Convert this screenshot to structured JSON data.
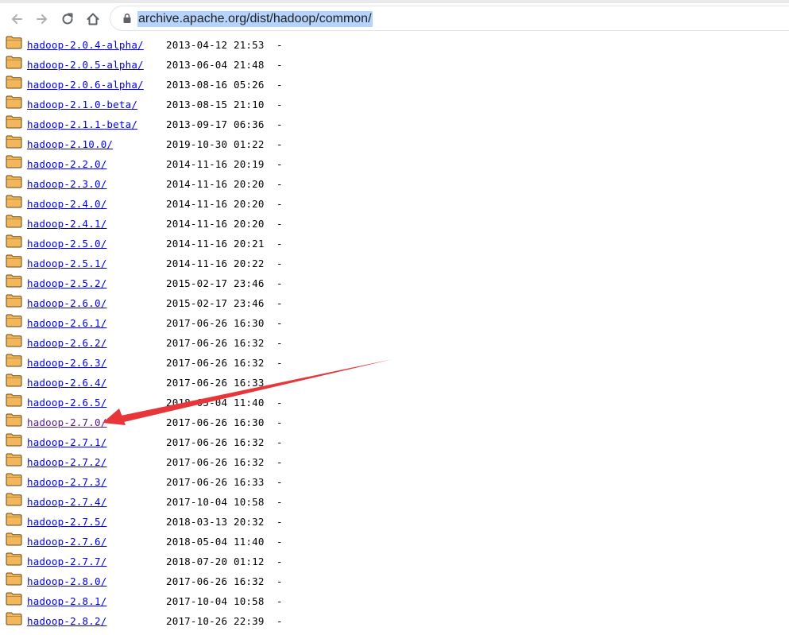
{
  "browser": {
    "url": "archive.apache.org/dist/hadoop/common/",
    "icons": [
      "back-icon",
      "forward-icon",
      "reload-icon",
      "home-icon",
      "lock-icon"
    ]
  },
  "listing": {
    "folder_icon": "folder-icon",
    "entries": [
      {
        "name": "hadoop-2.0.4-alpha/",
        "date": "2013-04-12 21:53",
        "size": "-"
      },
      {
        "name": "hadoop-2.0.5-alpha/",
        "date": "2013-06-04 21:48",
        "size": "-"
      },
      {
        "name": "hadoop-2.0.6-alpha/",
        "date": "2013-08-16 05:26",
        "size": "-"
      },
      {
        "name": "hadoop-2.1.0-beta/",
        "date": "2013-08-15 21:10",
        "size": "-"
      },
      {
        "name": "hadoop-2.1.1-beta/",
        "date": "2013-09-17 06:36",
        "size": "-"
      },
      {
        "name": "hadoop-2.10.0/",
        "date": "2019-10-30 01:22",
        "size": "-"
      },
      {
        "name": "hadoop-2.2.0/",
        "date": "2014-11-16 20:19",
        "size": "-"
      },
      {
        "name": "hadoop-2.3.0/",
        "date": "2014-11-16 20:20",
        "size": "-"
      },
      {
        "name": "hadoop-2.4.0/",
        "date": "2014-11-16 20:20",
        "size": "-"
      },
      {
        "name": "hadoop-2.4.1/",
        "date": "2014-11-16 20:20",
        "size": "-"
      },
      {
        "name": "hadoop-2.5.0/",
        "date": "2014-11-16 20:21",
        "size": "-"
      },
      {
        "name": "hadoop-2.5.1/",
        "date": "2014-11-16 20:22",
        "size": "-"
      },
      {
        "name": "hadoop-2.5.2/",
        "date": "2015-02-17 23:46",
        "size": "-"
      },
      {
        "name": "hadoop-2.6.0/",
        "date": "2015-02-17 23:46",
        "size": "-"
      },
      {
        "name": "hadoop-2.6.1/",
        "date": "2017-06-26 16:30",
        "size": "-"
      },
      {
        "name": "hadoop-2.6.2/",
        "date": "2017-06-26 16:32",
        "size": "-"
      },
      {
        "name": "hadoop-2.6.3/",
        "date": "2017-06-26 16:32",
        "size": "-"
      },
      {
        "name": "hadoop-2.6.4/",
        "date": "2017-06-26 16:33",
        "size": "-"
      },
      {
        "name": "hadoop-2.6.5/",
        "date": "2018-05-04 11:40",
        "size": "-"
      },
      {
        "name": "hadoop-2.7.0/",
        "date": "2017-06-26 16:30",
        "size": "-",
        "visited": true
      },
      {
        "name": "hadoop-2.7.1/",
        "date": "2017-06-26 16:32",
        "size": "-"
      },
      {
        "name": "hadoop-2.7.2/",
        "date": "2017-06-26 16:32",
        "size": "-"
      },
      {
        "name": "hadoop-2.7.3/",
        "date": "2017-06-26 16:33",
        "size": "-"
      },
      {
        "name": "hadoop-2.7.4/",
        "date": "2017-10-04 10:58",
        "size": "-"
      },
      {
        "name": "hadoop-2.7.5/",
        "date": "2018-03-13 20:32",
        "size": "-"
      },
      {
        "name": "hadoop-2.7.6/",
        "date": "2018-05-04 11:40",
        "size": "-"
      },
      {
        "name": "hadoop-2.7.7/",
        "date": "2018-07-20 01:12",
        "size": "-"
      },
      {
        "name": "hadoop-2.8.0/",
        "date": "2017-06-26 16:32",
        "size": "-"
      },
      {
        "name": "hadoop-2.8.1/",
        "date": "2017-10-04 10:58",
        "size": "-"
      },
      {
        "name": "hadoop-2.8.2/",
        "date": "2017-10-26 22:39",
        "size": "-"
      }
    ]
  },
  "annotation": {
    "arrow_color": "#e8353a",
    "points_to": "hadoop-2.7.0/"
  },
  "colors": {
    "link": "#0000ee",
    "visited_link": "#551a8b",
    "url_highlight": "#b4d4fb",
    "folder_fill": "#f2b75d"
  }
}
